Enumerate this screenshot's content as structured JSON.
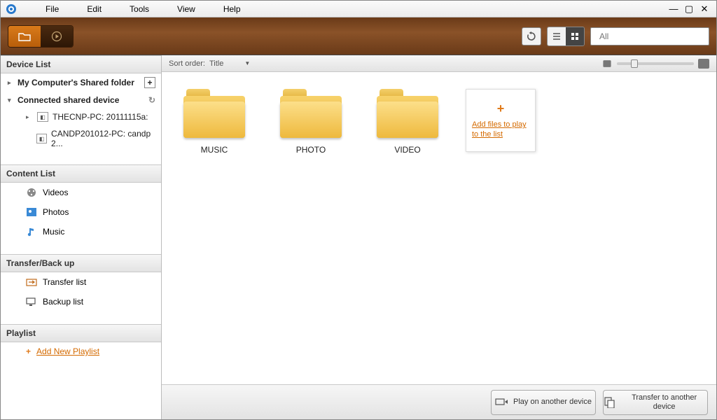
{
  "menu": {
    "items": [
      "File",
      "Edit",
      "Tools",
      "View",
      "Help"
    ]
  },
  "toolbar": {
    "search_placeholder": "All"
  },
  "sidebar": {
    "device_list_header": "Device List",
    "my_computer_shared": "My Computer's Shared folder",
    "connected_header": "Connected shared device",
    "devices": [
      "THECNP-PC: 20111115a:",
      "CANDP201012-PC: candp 2..."
    ],
    "content_list_header": "Content List",
    "content_items": [
      "Videos",
      "Photos",
      "Music"
    ],
    "transfer_header": "Transfer/Back up",
    "transfer_items": [
      "Transfer list",
      "Backup list"
    ],
    "playlist_header": "Playlist",
    "add_playlist": "Add New Playlist"
  },
  "main": {
    "sort_label": "Sort order:",
    "sort_value": "Title",
    "folders": [
      "MUSIC",
      "PHOTO",
      "VIDEO"
    ],
    "add_tile": "Add files to play to the list"
  },
  "footer": {
    "play_another": "Play on another device",
    "transfer_another": "Transfer to another device"
  }
}
